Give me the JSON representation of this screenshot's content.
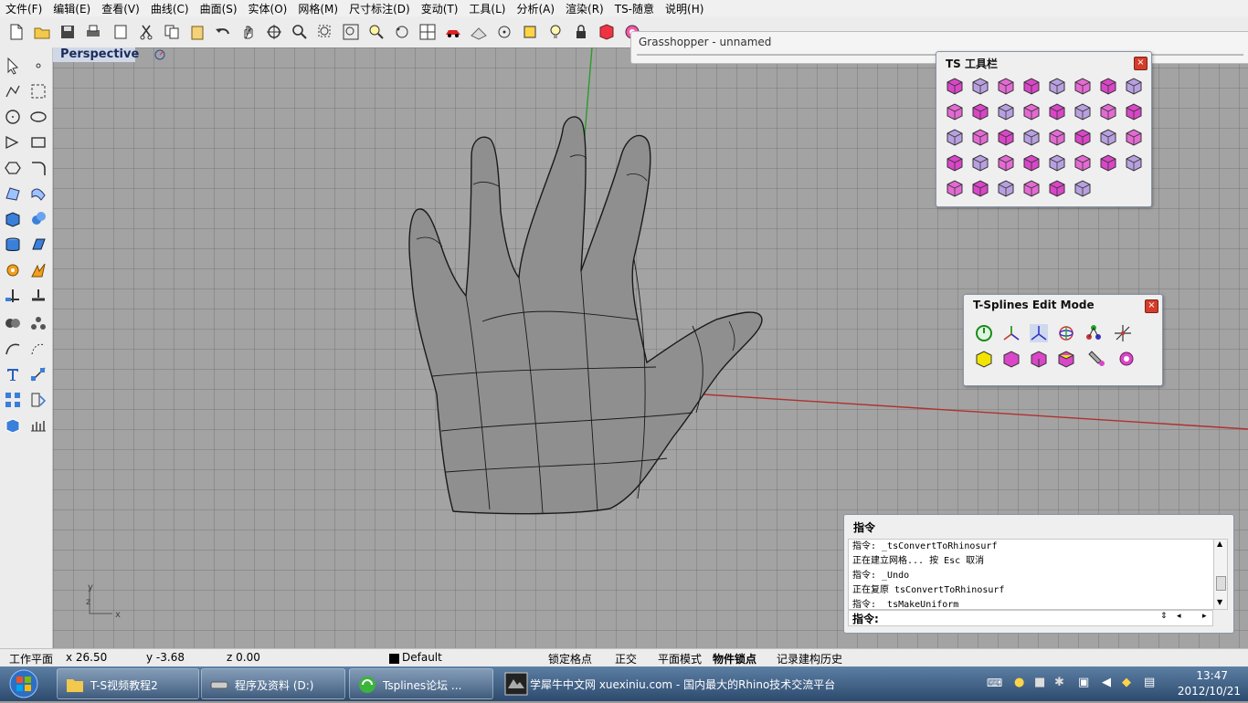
{
  "menu": [
    "文件(F)",
    "编辑(E)",
    "查看(V)",
    "曲线(C)",
    "曲面(S)",
    "实体(O)",
    "网格(M)",
    "尺寸标注(D)",
    "变动(T)",
    "工具(L)",
    "分析(A)",
    "渲染(R)",
    "TS-随意",
    "说明(H)"
  ],
  "viewport": {
    "title": "Perspective"
  },
  "grasshopper": {
    "title": "Grasshopper - unnamed"
  },
  "ts_toolbar": {
    "title": "TS 工具栏",
    "close": "×"
  },
  "ts_edit": {
    "title": "T-Splines Edit Mode",
    "close": "×"
  },
  "command": {
    "title": "指令",
    "log": [
      "指令: _tsConvertToRhinosurf",
      "正在建立网格... 按 Esc 取消",
      "指令: _Undo",
      "正在复原 tsConvertToRhinosurf",
      "指令: _tsMakeUniform"
    ],
    "prompt": "指令:"
  },
  "axes": {
    "x": "x",
    "y": "y",
    "z": "z"
  },
  "status": {
    "cplane": "工作平面",
    "x": "x 26.50",
    "y": "y -3.68",
    "z": "z 0.00",
    "layer": "Default",
    "snap": "锁定格点",
    "ortho": "正交",
    "planar": "平面模式",
    "osnap": "物件锁点",
    "history": "记录建构历史"
  },
  "taskbar": {
    "items": [
      {
        "label": "T-S视频教程2"
      },
      {
        "label": "程序及资料 (D:)"
      },
      {
        "label": "Tsplines论坛 ..."
      },
      {
        "label": "学犀牛中文网 xuexiniu.com - 国内最大的Rhino技术交流平台"
      }
    ],
    "time": "13:47",
    "date": "2012/10/21"
  },
  "colors": {
    "accent_magenta": "#d946c7",
    "axis_red": "#b03030",
    "axis_green": "#2c9a2c",
    "viewport_bg": "#a3a3a3"
  }
}
